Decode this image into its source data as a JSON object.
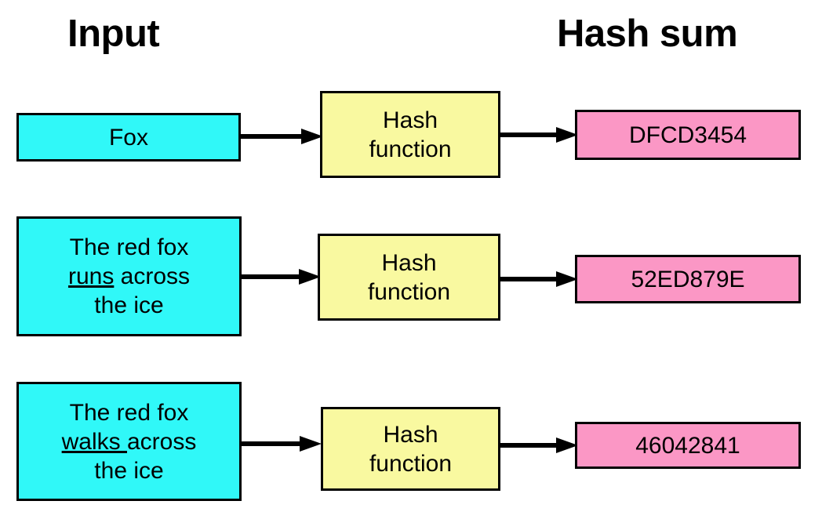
{
  "headings": {
    "input": "Input",
    "hash_sum": "Hash sum"
  },
  "colors": {
    "input_box": "#30f8f8",
    "function_box": "#f9f9a0",
    "hash_box": "#fb97c5",
    "border": "#000000",
    "background": "#ffffff",
    "text": "#000000"
  },
  "function_label": {
    "line1": "Hash",
    "line2": "function"
  },
  "rows": [
    {
      "input": {
        "full_text": "Fox",
        "prefix": "Fox",
        "emphasis": "",
        "suffix": "",
        "lines": [
          "Fox"
        ]
      },
      "function": "Hash function",
      "hash": "DFCD3454"
    },
    {
      "input": {
        "full_text": "The red fox runs across the ice",
        "prefix": "The red fox ",
        "emphasis": "runs",
        "suffix": " across the ice",
        "lines": [
          "The red fox",
          "runs across",
          "the ice"
        ]
      },
      "function": "Hash function",
      "hash": "52ED879E"
    },
    {
      "input": {
        "full_text": "The red fox walks across the ice",
        "prefix": "The red fox ",
        "emphasis": "walks ",
        "suffix": "across the ice",
        "lines": [
          "The red fox",
          "walks across",
          "the ice"
        ]
      },
      "function": "Hash function",
      "hash": "46042841"
    }
  ],
  "arrow_count": 6
}
